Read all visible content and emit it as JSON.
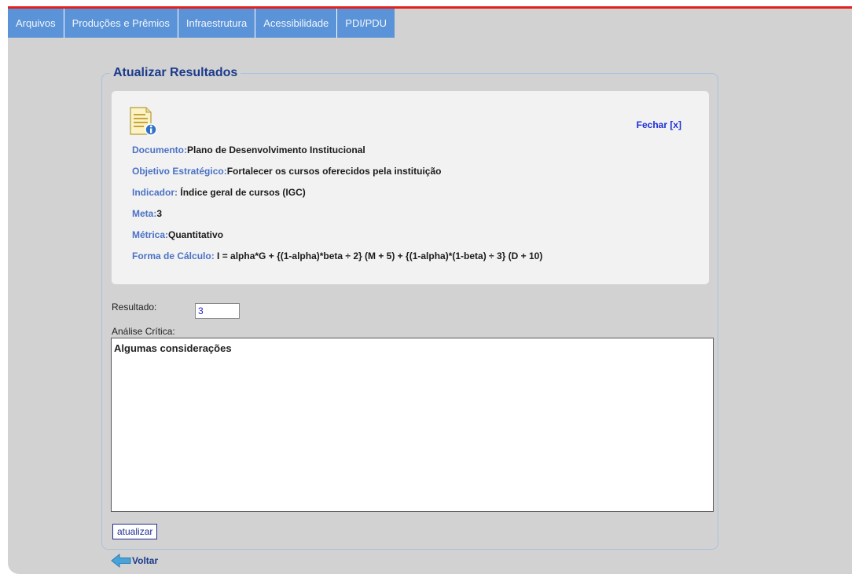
{
  "tabs": [
    {
      "label": "Arquivos"
    },
    {
      "label": "Produções e Prêmios"
    },
    {
      "label": "Infraestrutura"
    },
    {
      "label": "Acessibilidade"
    },
    {
      "label": "PDI/PDU"
    }
  ],
  "panel": {
    "title": "Atualizar Resultados",
    "close_label": "Fechar [x]",
    "info": {
      "documento": {
        "label": "Documento:",
        "value": "Plano de Desenvolvimento Institucional"
      },
      "objetivo": {
        "label": "Objetivo Estratégico:",
        "value": "Fortalecer os cursos oferecidos pela instituição"
      },
      "indicador": {
        "label": "Indicador:",
        "value": "Índice geral de cursos (IGC)"
      },
      "meta": {
        "label": "Meta:",
        "value": "3"
      },
      "metrica": {
        "label": "Métrica:",
        "value": "Quantitativo"
      },
      "calculo": {
        "label": "Forma de Cálculo:",
        "value": "I = alpha*G + {(1-alpha)*beta ÷ 2} (M + 5) + {(1-alpha)*(1-beta) ÷ 3} (D + 10)"
      }
    }
  },
  "form": {
    "result_label": "Resultado:",
    "result_value": "3",
    "analise_label": "Análise Crítica:",
    "analise_value": "Algumas considerações",
    "submit_label": "atualizar"
  },
  "back_label": "Voltar",
  "colors": {
    "tab_bg": "#5a93d8",
    "accent_red": "#e2201c",
    "title_blue": "#1b3a8c",
    "label_blue": "#4b72c6",
    "link_blue": "#1a2fd6"
  },
  "icons": {
    "document": "document-info-icon",
    "back": "back-arrow-icon"
  }
}
